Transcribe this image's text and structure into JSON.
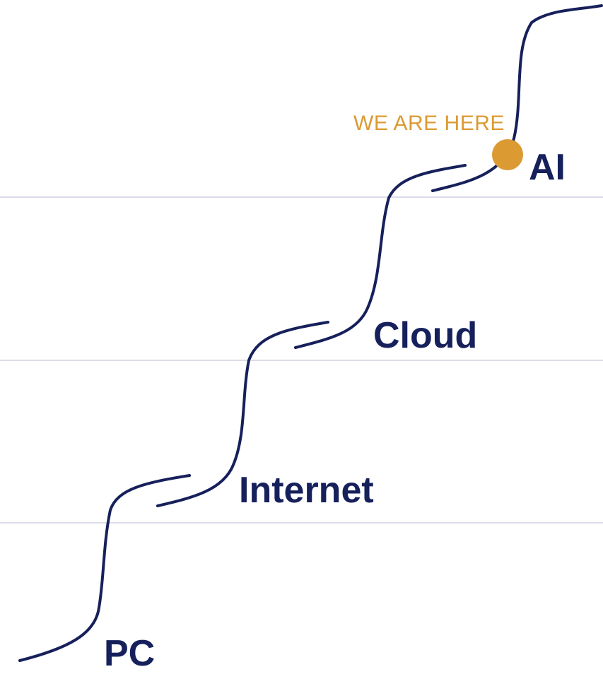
{
  "colors": {
    "primary": "#16205b",
    "accent": "#dc9a33",
    "divider": "#cfd0e2",
    "background": "#ffffff"
  },
  "stages": [
    {
      "id": "pc",
      "label": "PC"
    },
    {
      "id": "internet",
      "label": "Internet"
    },
    {
      "id": "cloud",
      "label": "Cloud"
    },
    {
      "id": "ai",
      "label": "AI"
    }
  ],
  "current_position": {
    "label": "WE ARE HERE",
    "stage": "ai"
  }
}
